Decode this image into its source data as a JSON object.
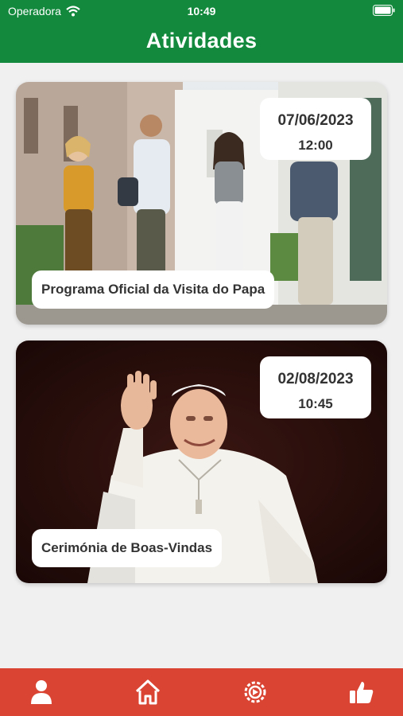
{
  "status_bar": {
    "carrier": "Operadora",
    "time": "10:49"
  },
  "header": {
    "title": "Atividades"
  },
  "activities": [
    {
      "title": "Programa Oficial da Visita do Papa",
      "date": "07/06/2023",
      "time": "12:00"
    },
    {
      "title": "Cerimónia de Boas-Vindas",
      "date": "02/08/2023",
      "time": "10:45"
    }
  ],
  "tabs": [
    {
      "icon": "user-icon"
    },
    {
      "icon": "home-icon"
    },
    {
      "icon": "settings-icon"
    },
    {
      "icon": "thumbs-up-icon"
    }
  ],
  "colors": {
    "header": "#12893d",
    "tabbar": "#d94532",
    "background": "#f0f0f0"
  }
}
